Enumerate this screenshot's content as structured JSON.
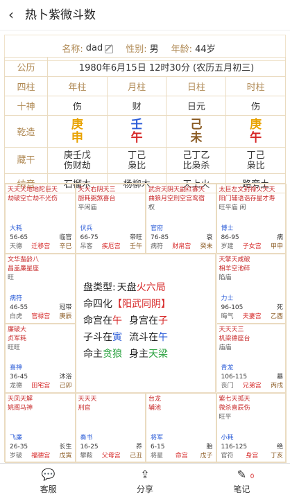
{
  "header": {
    "title": "热卜紫微斗数"
  },
  "profile": {
    "name_label": "名称:",
    "name": "dad",
    "gender_label": "性别:",
    "gender": "男",
    "age_label": "年龄:",
    "age": "44岁"
  },
  "calendar": {
    "label": "公历",
    "value": "1980年6月15日 12时30分 (农历五月初三)"
  },
  "pillars": {
    "label": "四柱",
    "cols": [
      "年柱",
      "月柱",
      "日柱",
      "时柱"
    ],
    "shishen_label": "十神",
    "shishen": [
      "伤",
      "财",
      "日元",
      "伤"
    ],
    "qianzao_label": "乾造",
    "gan": [
      "庚",
      "壬",
      "己",
      "庚"
    ],
    "zhi": [
      "申",
      "午",
      "未",
      "午"
    ],
    "canggan_label": "藏干",
    "canggan": [
      "庚壬戊",
      "丁己",
      "己丁乙",
      "丁己"
    ],
    "canggan_ss": [
      "伤财劫",
      "枭比",
      "比枭杀",
      "枭比"
    ],
    "nayin_label": "纳音",
    "nayin": [
      "石榴木",
      "杨柳木",
      "天上火",
      "路旁土"
    ]
  },
  "center": {
    "l1a": "盘类型:",
    "l1b": "天盘",
    "l1c": "火六局",
    "l2a": "命四化",
    "l2b": "【阳武同阴】",
    "l3a": "命宫在",
    "l3b": "午",
    "l3c": "身宫在",
    "l3d": "子",
    "l4a": "子斗在",
    "l4b": "寅",
    "l4c": "流斗在",
    "l4d": "午",
    "l5a": "命主",
    "l5b": "贪狼",
    "l5c": "身主",
    "l5d": "天梁"
  },
  "palaces": [
    {
      "stars": "天天天地地陀巨天",
      "sub": "劫破空亡劫不光伤",
      "god": "大耗",
      "age": "56-65",
      "state": "临官",
      "name": "天德",
      "b2": "迁移宫",
      "gz": "辛巳"
    },
    {
      "stars": "天大右阴天三",
      "sub": "厨耗弼煞喜台",
      "god": "伏兵",
      "age": "66-75",
      "state": "帝旺",
      "name": "吊客",
      "b2": "疾厄宫",
      "gz": "壬午",
      "extra": "平闲庙"
    },
    {
      "stars": "武贪天阴天副红寡天",
      "sub": "曲狼月空刑空宫鸾宿",
      "god": "官府",
      "age": "76-85",
      "state": "衰",
      "name": "病符",
      "b2": "财帛宫",
      "gz": "癸未",
      "extra": "权"
    },
    {
      "stars": "太巨左文封禄火天天",
      "sub": "阳门辅语诰存星才寿",
      "god": "博士",
      "age": "86-95",
      "state": "病",
      "name": "岁建",
      "b2": "子女宫",
      "gz": "甲申",
      "extra": "旺平庙 闲"
    },
    {
      "stars": "文华蜚龄八",
      "sub": "昌盖廉星座",
      "god": "病符",
      "age": "46-55",
      "state": "冠带",
      "name": "白虎",
      "b2": "官禄宫",
      "gz": "庚辰",
      "extra": "旺"
    },
    {
      "stars": "天擎天咸破",
      "sub": "相羊空池碎",
      "god": "力士",
      "age": "96-105",
      "state": "死",
      "name": "晦气",
      "b2": "夫妻宫",
      "gz": "乙酉",
      "extra": "陷庙"
    },
    {
      "stars": "廉破大",
      "sub": "贞军耗",
      "god": "喜神",
      "age": "36-45",
      "state": "沐浴",
      "name": "龙德",
      "b2": "田宅宫",
      "gz": "己卯",
      "extra": "旺旺"
    },
    {
      "stars": "天天天三",
      "sub": "机梁德座台",
      "god": "青龙",
      "age": "106-115",
      "state": "墓",
      "name": "丧门",
      "b2": "兄弟宫",
      "gz": "丙戌",
      "extra": "庙庙"
    },
    {
      "stars": "天凤天解",
      "sub": "姚阁马神",
      "god": "飞廉",
      "age": "26-35",
      "state": "长生",
      "name": "岁破",
      "b2": "福德宫",
      "gz": "戊寅"
    },
    {
      "stars": "天天天",
      "sub": "刑官",
      "god": "奏书",
      "age": "16-25",
      "state": "养",
      "name": "攀鞍",
      "b2": "父母宫",
      "gz": "己丑"
    },
    {
      "stars": "台龙",
      "sub": "辅池",
      "god": "将军",
      "age": "6-15",
      "state": "胎",
      "name": "将星",
      "b2": "命宫",
      "gz": "戊子"
    },
    {
      "stars": "紫七天孤天",
      "sub": "微杀喜辰伤",
      "god": "小耗",
      "age": "116-125",
      "state": "绝",
      "name": "官符",
      "b2": "身宫",
      "gz": "丁亥",
      "extra": "旺平"
    }
  ],
  "tabs": [
    {
      "label": "客服",
      "icon": "chat-icon"
    },
    {
      "label": "分享",
      "icon": "share-icon"
    },
    {
      "label": "笔记",
      "icon": "note-icon",
      "badge": "0"
    }
  ]
}
